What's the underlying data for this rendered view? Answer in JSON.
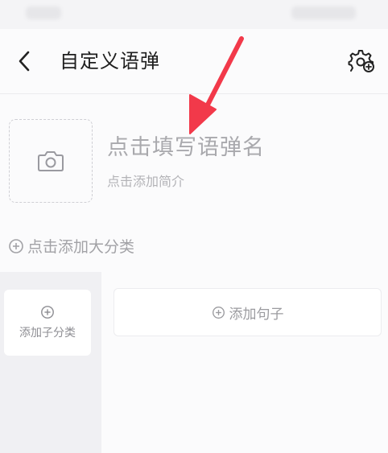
{
  "header": {
    "back_icon": "chevron-left-icon",
    "title": "自定义语弹",
    "settings_icon": "gear-plus-icon"
  },
  "cover": {
    "icon": "camera-icon"
  },
  "name_field": {
    "placeholder": "点击填写语弹名"
  },
  "intro_field": {
    "placeholder": "点击添加简介"
  },
  "category": {
    "add_label": "点击添加大分类",
    "icon": "plus-circle-icon"
  },
  "subcategory": {
    "add_label": "添加子分类",
    "icon": "plus-circle-icon"
  },
  "sentence": {
    "add_label": "添加句子",
    "icon": "plus-circle-icon"
  },
  "colors": {
    "annotation_arrow": "#f2394a",
    "placeholder_text": "#a9a9ad",
    "left_pane_bg": "#f0f0f3"
  }
}
